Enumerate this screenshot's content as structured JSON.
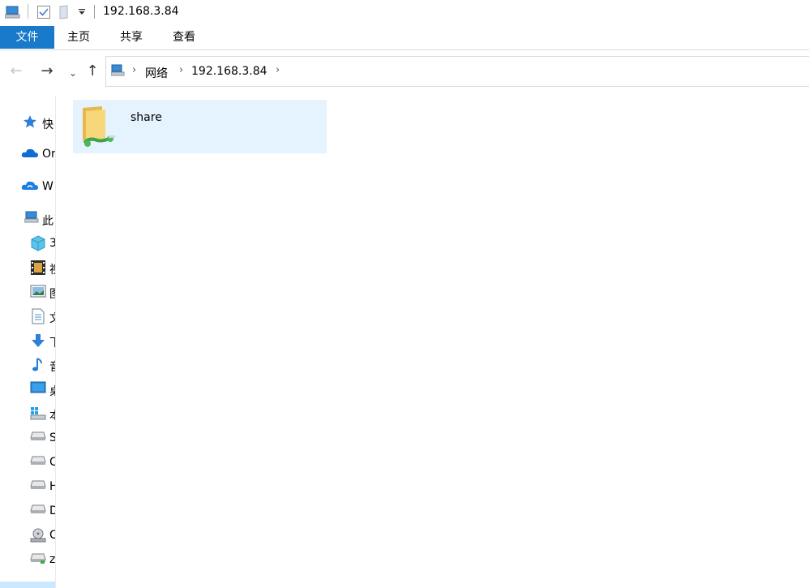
{
  "window": {
    "title": "192.168.3.84"
  },
  "ribbon": {
    "tabs": [
      "文件",
      "主页",
      "共享",
      "查看"
    ]
  },
  "address": {
    "crumbs": [
      "网络",
      "192.168.3.84"
    ]
  },
  "sidebar": {
    "items": [
      {
        "label": "快",
        "icon": "quick-access-star-icon"
      },
      {
        "label": "Or",
        "icon": "onedrive-cloud-icon"
      },
      {
        "label": "W",
        "icon": "wps-cloud-icon"
      },
      {
        "label": "此",
        "icon": "this-pc-icon"
      },
      {
        "label": "3",
        "icon": "3d-objects-icon"
      },
      {
        "label": "视",
        "icon": "videos-icon"
      },
      {
        "label": "图",
        "icon": "pictures-icon"
      },
      {
        "label": "文",
        "icon": "documents-icon"
      },
      {
        "label": "下",
        "icon": "downloads-icon"
      },
      {
        "label": "音",
        "icon": "music-icon"
      },
      {
        "label": "桌",
        "icon": "desktop-icon"
      },
      {
        "label": "本",
        "icon": "windows-drive-icon"
      },
      {
        "label": "S",
        "icon": "drive-icon"
      },
      {
        "label": "C",
        "icon": "drive-icon"
      },
      {
        "label": "H",
        "icon": "drive-icon"
      },
      {
        "label": "D",
        "icon": "drive-icon"
      },
      {
        "label": "C",
        "icon": "cd-drive-icon"
      },
      {
        "label": "z",
        "icon": "network-drive-icon"
      }
    ]
  },
  "content": {
    "items": [
      {
        "name": "share",
        "icon": "shared-folder-icon"
      }
    ]
  },
  "colors": {
    "accent": "#1979ca",
    "selection": "#e5f3ff"
  }
}
